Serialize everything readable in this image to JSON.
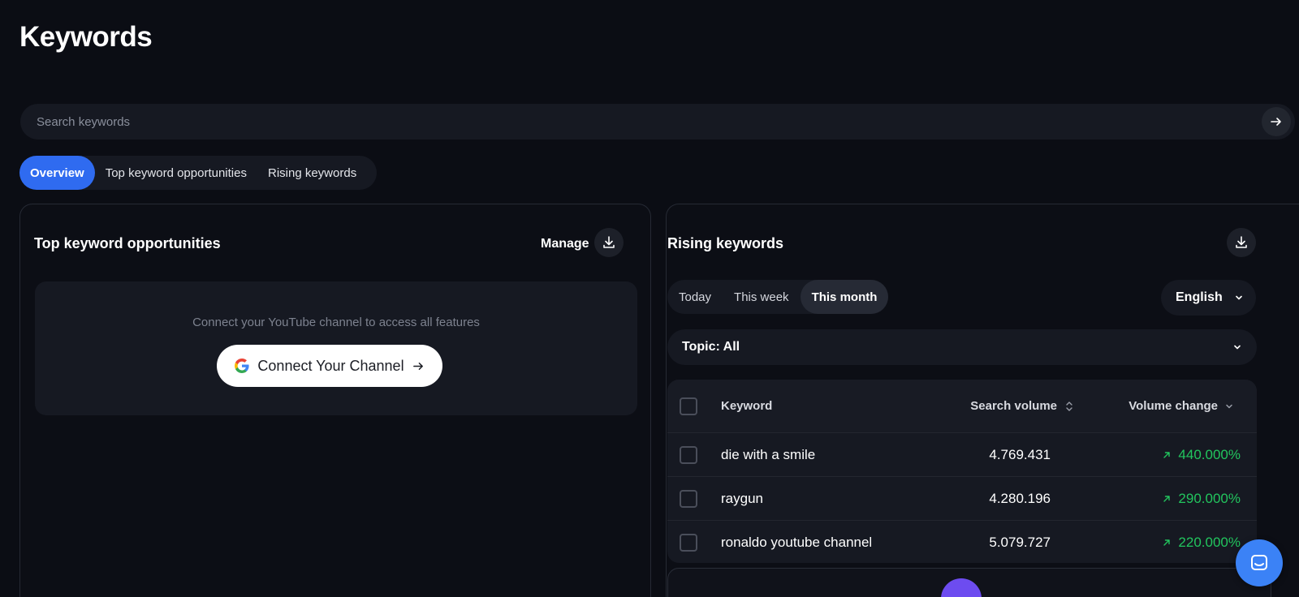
{
  "page": {
    "title": "Keywords"
  },
  "search": {
    "placeholder": "Search keywords",
    "value": ""
  },
  "tabs": [
    {
      "label": "Overview",
      "active": true
    },
    {
      "label": "Top keyword opportunities",
      "active": false
    },
    {
      "label": "Rising keywords",
      "active": false
    }
  ],
  "top_opportunities": {
    "title": "Top keyword opportunities",
    "manage_label": "Manage",
    "connect_message": "Connect your YouTube channel to access all features",
    "connect_button_label": "Connect Your Channel"
  },
  "rising": {
    "title": "Rising keywords",
    "periods": [
      {
        "label": "Today",
        "active": false
      },
      {
        "label": "This week",
        "active": false
      },
      {
        "label": "This month",
        "active": true
      }
    ],
    "language": "English",
    "topic": "Topic: All",
    "columns": {
      "keyword": "Keyword",
      "volume": "Search volume",
      "change": "Volume change"
    },
    "rows": [
      {
        "keyword": "die with a smile",
        "volume": "4.769.431",
        "change": "440.000%"
      },
      {
        "keyword": "raygun",
        "volume": "4.280.196",
        "change": "290.000%"
      },
      {
        "keyword": "ronaldo youtube channel",
        "volume": "5.079.727",
        "change": "220.000%"
      }
    ]
  },
  "colors": {
    "accent": "#2f6bf0",
    "positive": "#22c55e",
    "background": "#0b0d14"
  },
  "icons": [
    "arrow-right-icon",
    "download-icon",
    "google-icon",
    "chevron-down-icon",
    "sort-icon",
    "trend-up-icon",
    "chat-icon"
  ]
}
